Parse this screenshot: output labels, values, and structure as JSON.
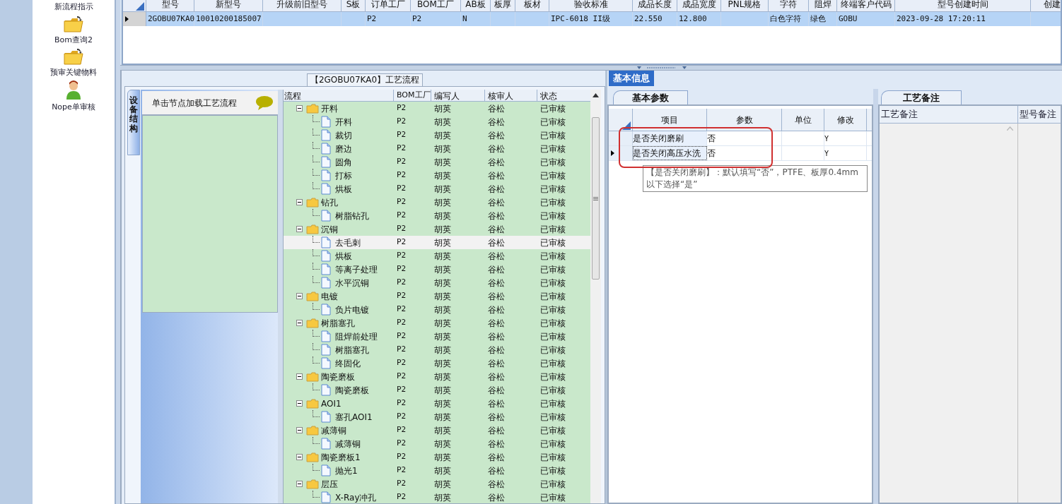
{
  "sidebar": {
    "items": [
      {
        "label": "新流程指示",
        "kind": "none"
      },
      {
        "label": "Bom查询2",
        "kind": "folder"
      },
      {
        "label": "预审关键物料",
        "kind": "folder"
      },
      {
        "label": "Nope单审核",
        "kind": "person"
      }
    ]
  },
  "main_grid": {
    "columns": [
      "型号",
      "新型号",
      "升级前旧型号",
      "S板",
      "订单工厂",
      "BOM工厂",
      "AB板",
      "板厚",
      "板材",
      "验收标准",
      "成品长度",
      "成品宽度",
      "PNL规格",
      "字符",
      "阻焊",
      "终端客户代码",
      "型号创建时间",
      "创建"
    ],
    "rows": [
      {
        "selected": true,
        "cells": [
          "2GOBU07KA0",
          "10010200185007",
          "",
          "",
          "P2",
          "P2",
          "N",
          "",
          "",
          "IPC-6018 II级",
          "22.550",
          "12.800",
          "",
          "白色字符",
          "绿色",
          "GOBU",
          "2023-09-28 17:20:11",
          ""
        ]
      }
    ]
  },
  "process_panel": {
    "title": "【2GOBU07KA0】工艺流程",
    "side_tab": "设备结构",
    "hint": "单击节点加载工艺流程",
    "columns": [
      "流程",
      "BOM工厂",
      "编写人",
      "核审人",
      "状态"
    ],
    "tree": [
      {
        "name": "开料",
        "bom": "P2",
        "writer": "胡英",
        "reviewer": "谷松",
        "status": "已审核",
        "expanded": true,
        "selected": false,
        "children": [
          {
            "name": "开料",
            "bom": "P2",
            "writer": "胡英",
            "reviewer": "谷松",
            "status": "已审核",
            "selected": false
          },
          {
            "name": "裁切",
            "bom": "P2",
            "writer": "胡英",
            "reviewer": "谷松",
            "status": "已审核",
            "selected": false
          },
          {
            "name": "磨边",
            "bom": "P2",
            "writer": "胡英",
            "reviewer": "谷松",
            "status": "已审核",
            "selected": false
          },
          {
            "name": "圆角",
            "bom": "P2",
            "writer": "胡英",
            "reviewer": "谷松",
            "status": "已审核",
            "selected": false
          },
          {
            "name": "打标",
            "bom": "P2",
            "writer": "胡英",
            "reviewer": "谷松",
            "status": "已审核",
            "selected": false
          },
          {
            "name": "烘板",
            "bom": "P2",
            "writer": "胡英",
            "reviewer": "谷松",
            "status": "已审核",
            "selected": false
          }
        ]
      },
      {
        "name": "钻孔",
        "bom": "P2",
        "writer": "胡英",
        "reviewer": "谷松",
        "status": "已审核",
        "expanded": true,
        "selected": false,
        "children": [
          {
            "name": "树脂钻孔",
            "bom": "P2",
            "writer": "胡英",
            "reviewer": "谷松",
            "status": "已审核",
            "selected": false
          }
        ]
      },
      {
        "name": "沉铜",
        "bom": "P2",
        "writer": "胡英",
        "reviewer": "谷松",
        "status": "已审核",
        "expanded": true,
        "selected": false,
        "children": [
          {
            "name": "去毛刺",
            "bom": "P2",
            "writer": "胡英",
            "reviewer": "谷松",
            "status": "已审核",
            "selected": true
          },
          {
            "name": "烘板",
            "bom": "P2",
            "writer": "胡英",
            "reviewer": "谷松",
            "status": "已审核",
            "selected": false
          },
          {
            "name": "等离子处理",
            "bom": "P2",
            "writer": "胡英",
            "reviewer": "谷松",
            "status": "已审核",
            "selected": false
          },
          {
            "name": "水平沉铜",
            "bom": "P2",
            "writer": "胡英",
            "reviewer": "谷松",
            "status": "已审核",
            "selected": false
          }
        ]
      },
      {
        "name": "电镀",
        "bom": "P2",
        "writer": "胡英",
        "reviewer": "谷松",
        "status": "已审核",
        "expanded": true,
        "selected": false,
        "children": [
          {
            "name": "负片电镀",
            "bom": "P2",
            "writer": "胡英",
            "reviewer": "谷松",
            "status": "已审核",
            "selected": false
          }
        ]
      },
      {
        "name": "树脂塞孔",
        "bom": "P2",
        "writer": "胡英",
        "reviewer": "谷松",
        "status": "已审核",
        "expanded": true,
        "selected": false,
        "children": [
          {
            "name": "阻焊前处理",
            "bom": "P2",
            "writer": "胡英",
            "reviewer": "谷松",
            "status": "已审核",
            "selected": false
          },
          {
            "name": "树脂塞孔",
            "bom": "P2",
            "writer": "胡英",
            "reviewer": "谷松",
            "status": "已审核",
            "selected": false
          },
          {
            "name": "终固化",
            "bom": "P2",
            "writer": "胡英",
            "reviewer": "谷松",
            "status": "已审核",
            "selected": false
          }
        ]
      },
      {
        "name": "陶瓷磨板",
        "bom": "P2",
        "writer": "胡英",
        "reviewer": "谷松",
        "status": "已审核",
        "expanded": true,
        "selected": false,
        "children": [
          {
            "name": "陶瓷磨板",
            "bom": "P2",
            "writer": "胡英",
            "reviewer": "谷松",
            "status": "已审核",
            "selected": false
          }
        ]
      },
      {
        "name": "AOI1",
        "bom": "P2",
        "writer": "胡英",
        "reviewer": "谷松",
        "status": "已审核",
        "expanded": true,
        "selected": false,
        "children": [
          {
            "name": "塞孔AOI1",
            "bom": "P2",
            "writer": "胡英",
            "reviewer": "谷松",
            "status": "已审核",
            "selected": false
          }
        ]
      },
      {
        "name": "减薄铜",
        "bom": "P2",
        "writer": "胡英",
        "reviewer": "谷松",
        "status": "已审核",
        "expanded": true,
        "selected": false,
        "children": [
          {
            "name": "减薄铜",
            "bom": "P2",
            "writer": "胡英",
            "reviewer": "谷松",
            "status": "已审核",
            "selected": false
          }
        ]
      },
      {
        "name": "陶瓷磨板1",
        "bom": "P2",
        "writer": "胡英",
        "reviewer": "谷松",
        "status": "已审核",
        "expanded": true,
        "selected": false,
        "children": [
          {
            "name": "抛光1",
            "bom": "P2",
            "writer": "胡英",
            "reviewer": "谷松",
            "status": "已审核",
            "selected": false
          }
        ]
      },
      {
        "name": "层压",
        "bom": "P2",
        "writer": "胡英",
        "reviewer": "谷松",
        "status": "已审核",
        "expanded": true,
        "selected": false,
        "children": [
          {
            "name": "X-Ray冲孔",
            "bom": "P2",
            "writer": "胡英",
            "reviewer": "谷松",
            "status": "已审核",
            "selected": false
          }
        ]
      }
    ]
  },
  "info_panel": {
    "tab": "基本信息",
    "params_tab": "基本参数",
    "param_columns": [
      "项目",
      "参数",
      "单位",
      "修改"
    ],
    "param_rows": [
      {
        "current": false,
        "cells": [
          "是否关闭磨刷",
          "否",
          "",
          "Y"
        ]
      },
      {
        "current": true,
        "cells": [
          "是否关闭高压水洗",
          "否",
          "",
          "Y"
        ]
      }
    ],
    "tooltip": "【是否关闭磨刷】：默认填写“否”，PTFE、板厚0.4mm以下选择“是”",
    "notes_tab": "工艺备注",
    "notes_columns": [
      "工艺备注",
      "型号备注"
    ]
  }
}
